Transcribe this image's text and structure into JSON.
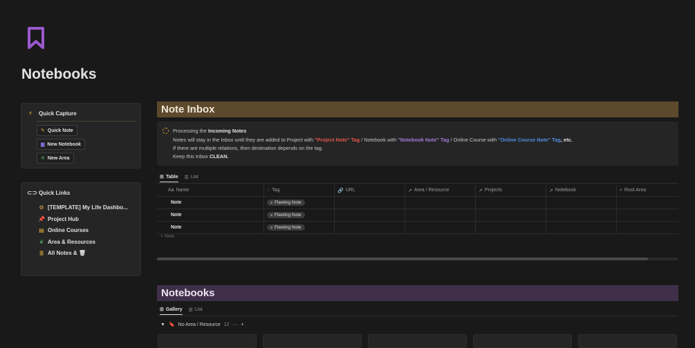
{
  "page": {
    "title": "Notebooks",
    "icon": "bookmark-icon",
    "accent": "#9b59d0"
  },
  "quick_capture": {
    "title": "Quick Capture",
    "icon": "lightning-icon",
    "buttons": [
      {
        "label": "Quick Note",
        "icon": "edit-icon"
      },
      {
        "label": "New Notebook",
        "icon": "book-icon"
      },
      {
        "label": "New Area",
        "icon": "sprout-icon"
      }
    ]
  },
  "quick_links": {
    "title": "Quick Links",
    "icon": "link-icon",
    "items": [
      {
        "label": "[TEMPLATE] My Life Dashbo...",
        "icon": "dashboard-icon"
      },
      {
        "label": "Project Hub",
        "icon": "pin-icon"
      },
      {
        "label": "Online Courses",
        "icon": "course-icon"
      },
      {
        "label": "Area & Resources",
        "icon": "plant-icon"
      },
      {
        "label": "All Notes & 🗑",
        "icon": "database-icon"
      }
    ]
  },
  "note_inbox": {
    "title": "Note Inbox",
    "banner_color": "#5d4a2c",
    "callout": {
      "line1_prefix": "Processing the ",
      "line1_bold": "Incoming Notes",
      "line2_a": "Notes will stay in the Inbox until they are added to Project with ",
      "line2_project_tag": "\"Project Note\" Tag",
      "line2_b": " / Notebook with ",
      "line2_notebook_tag": "\"Notebook Note\" Tag",
      "line2_c": " / Online Course with ",
      "line2_course_tag": "\"Online Course Note\" Tag",
      "line2_d": ", etc.",
      "line3": "If there are multiple relations, then destination depends on the tag.",
      "line4_prefix": "Keep this Inbox ",
      "line4_bold": "CLEAN."
    },
    "tabs": [
      {
        "label": "Table",
        "icon": "table-icon",
        "active": true
      },
      {
        "label": "List",
        "icon": "list-icon",
        "active": false
      }
    ],
    "columns": [
      {
        "label": "Name",
        "icon": "text-icon"
      },
      {
        "label": "Tag",
        "icon": "select-icon"
      },
      {
        "label": "URL",
        "icon": "link-icon"
      },
      {
        "label": "Area / Resource",
        "icon": "relation-icon"
      },
      {
        "label": "Projects",
        "icon": "relation-icon"
      },
      {
        "label": "Notebook",
        "icon": "relation-icon"
      },
      {
        "label": "Root Area",
        "icon": "search-icon"
      }
    ],
    "rows": [
      {
        "name": "Note",
        "tag": "Fleeting Note"
      },
      {
        "name": "Note",
        "tag": "Fleeting Note"
      },
      {
        "name": "Note",
        "tag": "Fleeting Note"
      }
    ],
    "new_label": "+ New"
  },
  "notebooks": {
    "title": "Notebooks",
    "banner_color": "#3f2f49",
    "tabs": [
      {
        "label": "Gallery",
        "icon": "gallery-icon",
        "active": true
      },
      {
        "label": "List",
        "icon": "list-icon",
        "active": false
      }
    ],
    "group": {
      "label": "No Area / Resource",
      "count": "12",
      "more": "···",
      "add": "+"
    }
  }
}
